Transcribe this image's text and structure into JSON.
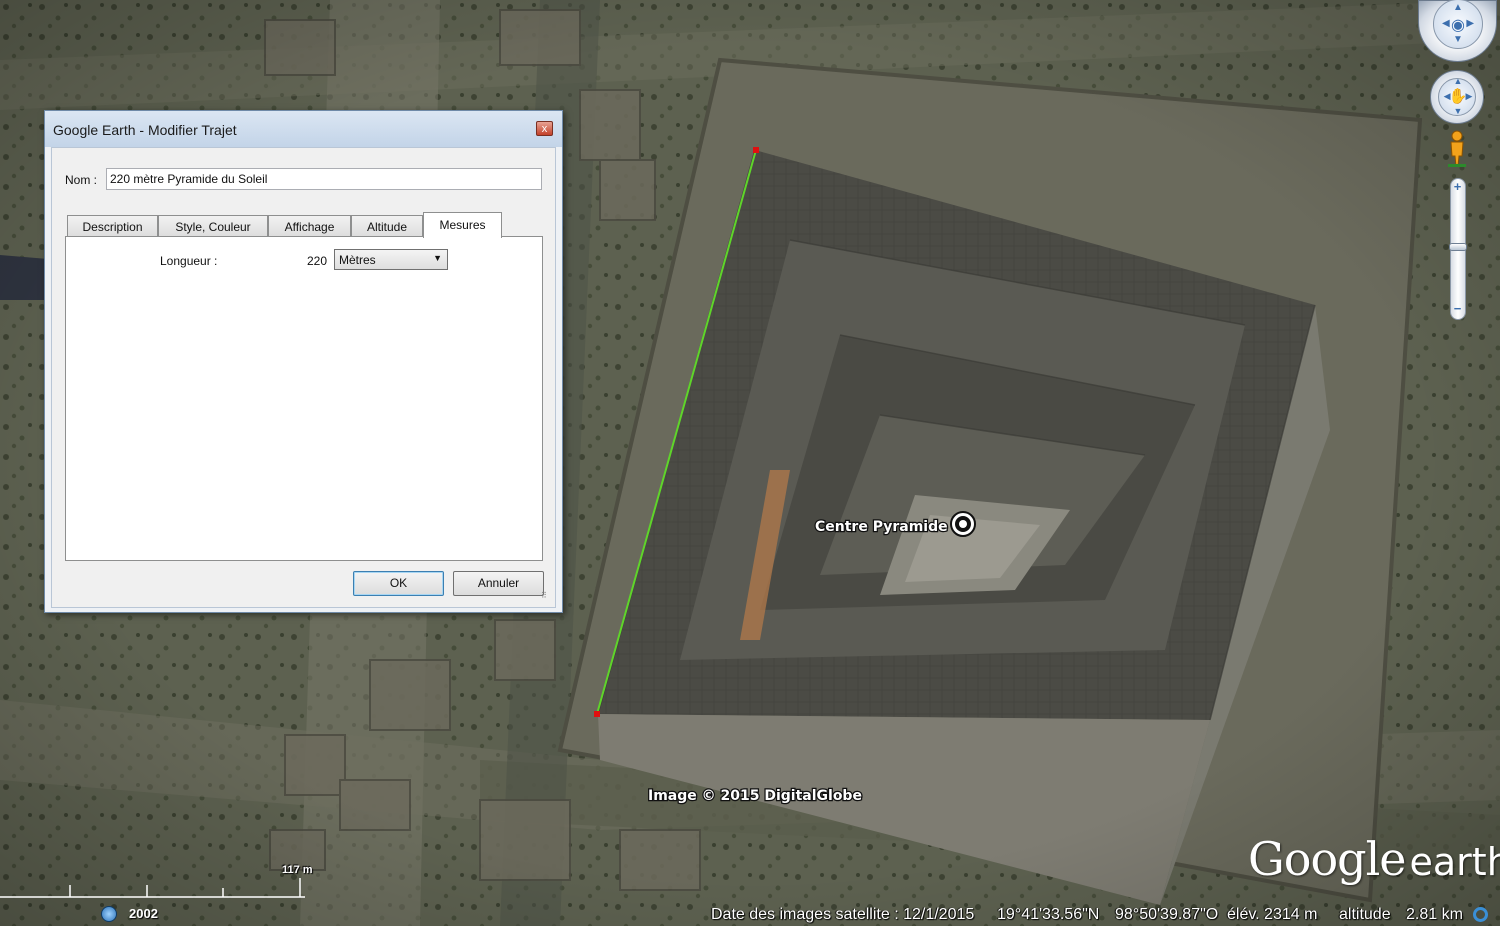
{
  "dialog": {
    "title": "Google Earth - Modifier Trajet",
    "close_symbol": "x",
    "name_label": "Nom :",
    "name_value": "220 mètre Pyramide du Soleil",
    "tabs": [
      {
        "label": "Description"
      },
      {
        "label": "Style, Couleur"
      },
      {
        "label": "Affichage"
      },
      {
        "label": "Altitude"
      },
      {
        "label": "Mesures"
      }
    ],
    "active_tab": "Mesures",
    "measures": {
      "length_label": "Longueur :",
      "length_value": "220",
      "unit": "Mètres"
    },
    "ok_label": "OK",
    "cancel_label": "Annuler"
  },
  "map": {
    "placemark_label": "Centre Pyramide",
    "path_color": "#5fd52a",
    "endpoint_color": "#e01010",
    "imagery_credit": "Image © 2015 DigitalGlobe"
  },
  "scale": {
    "label": "117 m"
  },
  "history": {
    "year": "2002"
  },
  "status": {
    "imagery_date": "Date des images satellite : 12/1/2015",
    "latitude": "19°41'33.56\"N",
    "longitude": "98°50'39.87\"O",
    "elevation": "élév. 2314 m",
    "altitude_label": "altitude",
    "altitude_value": "2.81 km"
  },
  "logo": {
    "google": "Google",
    "earth": "earth"
  },
  "icons": {
    "look_control": "eye-icon",
    "move_control": "hand-icon",
    "pegman": "pegman-icon",
    "zoom_in": "plus-icon",
    "zoom_out": "minus-icon",
    "streaming": "streaming-icon",
    "clock": "clock-icon"
  }
}
